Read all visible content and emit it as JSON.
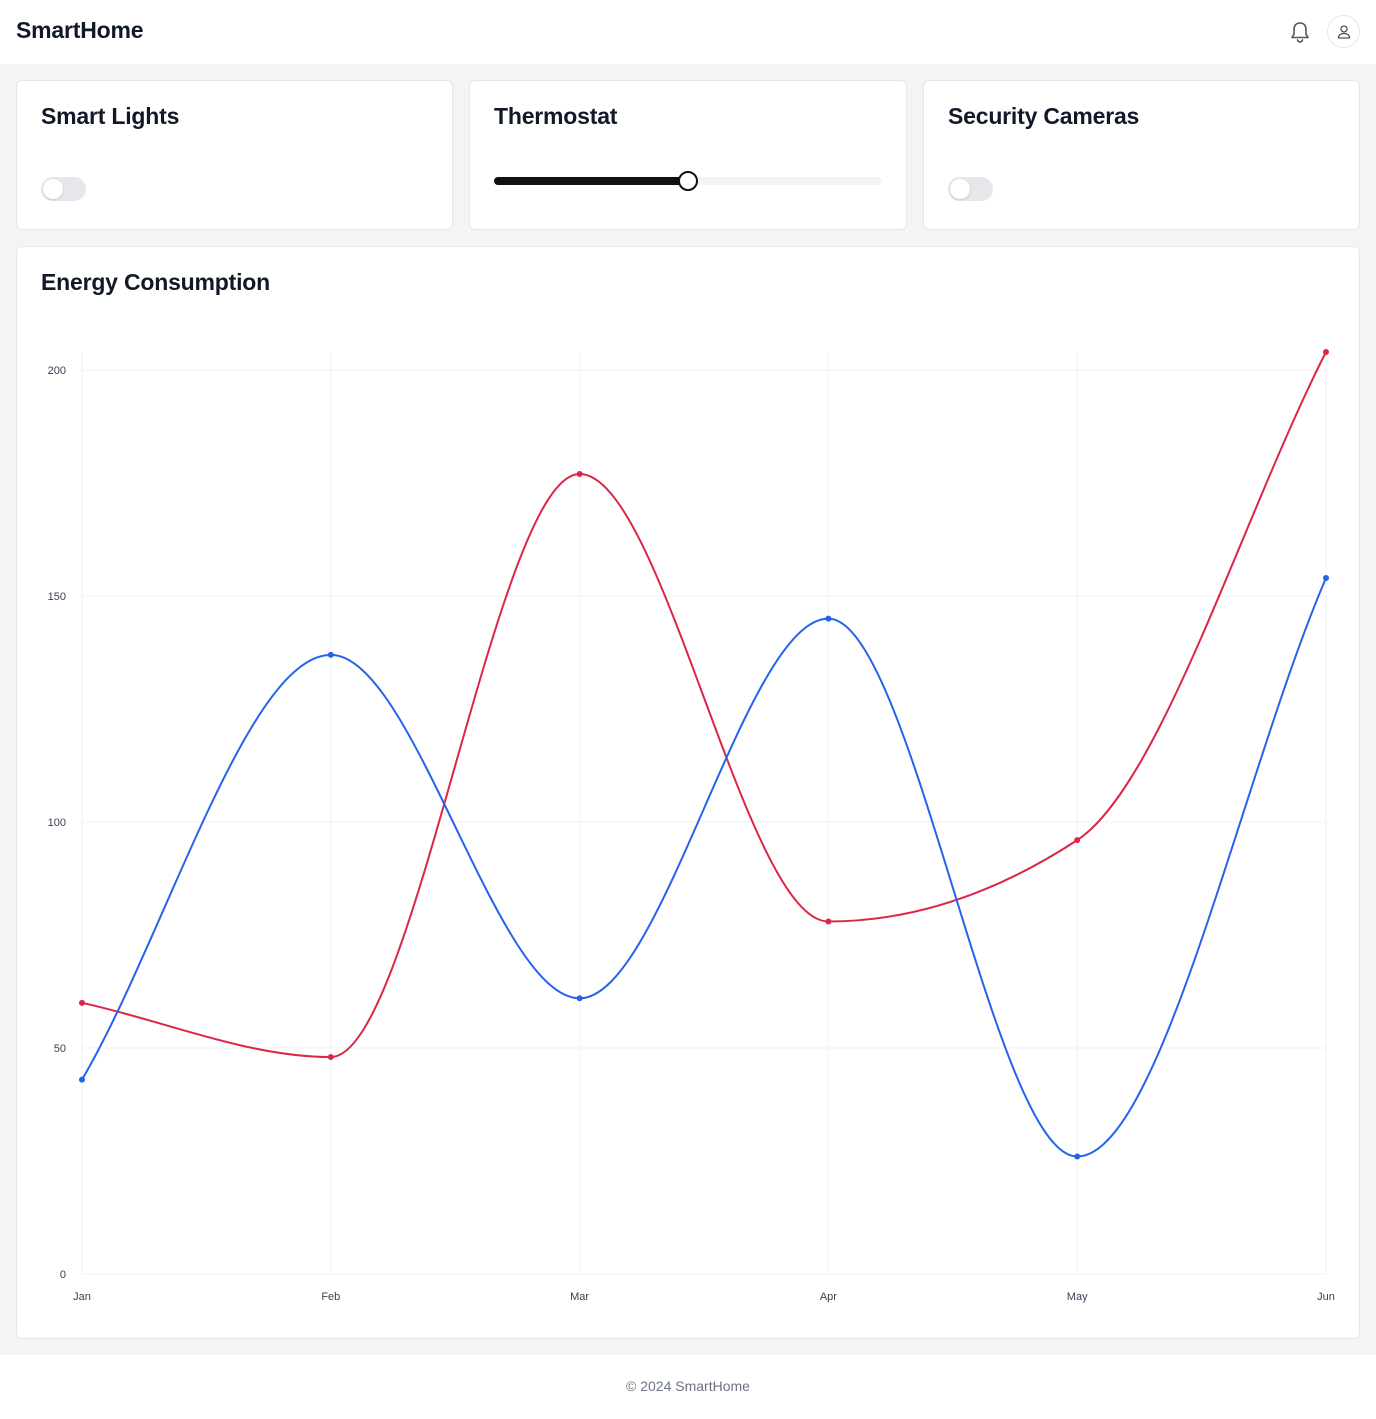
{
  "header": {
    "brand": "SmartHome",
    "notifications_icon": "bell-icon",
    "profile_icon": "user-icon"
  },
  "devices": {
    "lights": {
      "title": "Smart Lights",
      "on": false
    },
    "thermostat": {
      "title": "Thermostat",
      "level": 0.5
    },
    "cameras": {
      "title": "Security Cameras",
      "on": false
    }
  },
  "energy": {
    "title": "Energy Consumption"
  },
  "chart_data": {
    "type": "line",
    "title": "Energy Consumption",
    "categories": [
      "Jan",
      "Feb",
      "Mar",
      "Apr",
      "May",
      "Jun"
    ],
    "series": [
      {
        "color": "#dc2646",
        "values": [
          60,
          48,
          177,
          78,
          96,
          204
        ]
      },
      {
        "color": "#2563eb",
        "values": [
          43,
          137,
          61,
          145,
          26,
          154
        ]
      }
    ],
    "yticks": [
      0,
      50,
      100,
      150,
      200
    ],
    "ylim": [
      0,
      204
    ],
    "grid": true,
    "smooth": true,
    "xlabel": "",
    "ylabel": ""
  },
  "footer": {
    "text": "© 2024 SmartHome"
  },
  "colors": {
    "background": "#f3f4f6",
    "card": "#ffffff",
    "border": "#e5e7eb",
    "text": "#111827",
    "muted": "#6b7280",
    "slider_fill": "#111111"
  }
}
